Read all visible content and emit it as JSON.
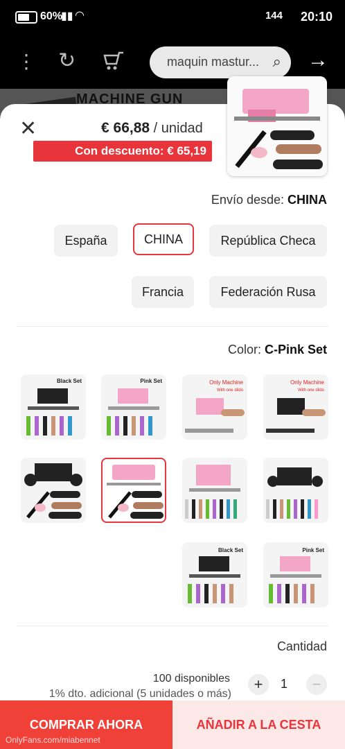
{
  "status_bar": {
    "time": "20:10",
    "battery_pct": "60%",
    "right_icons": "144"
  },
  "top_bar": {
    "search_placeholder": "maquin mastur..."
  },
  "background": {
    "product_text": "MACHINE GUN"
  },
  "sheet": {
    "price": "€ 66,88",
    "price_unit": " / unidad",
    "discount": "Con descuento: € 65,19",
    "shipping": {
      "label": "Envío desde: ",
      "value": "CHINA",
      "options": [
        "República Checa",
        "CHINA",
        "España",
        "Federación Rusa",
        "Francia"
      ]
    },
    "color": {
      "label": "Color: ",
      "value": "C-Pink Set",
      "option_labels": [
        "Only Machine",
        "With one dildo",
        "Pink Set",
        "Black Set"
      ]
    },
    "quantity": {
      "label": "Cantidad",
      "value": "1",
      "minus": "−",
      "plus": "+",
      "stock": "100 disponibles",
      "extra_discount": "1% dto. adicional (5 unidades o más)"
    },
    "buttons": {
      "add_to_cart": "AÑADIR A LA CESTA",
      "buy_now": "COMPRAR AHORA"
    },
    "watermark": "OnlyFans.com/miabennet"
  },
  "colors": {
    "accent": "#e8343b",
    "buy_bg": "#ef4138",
    "cart_bg": "#fde8e8",
    "chip_bg": "#f2f2f2"
  }
}
